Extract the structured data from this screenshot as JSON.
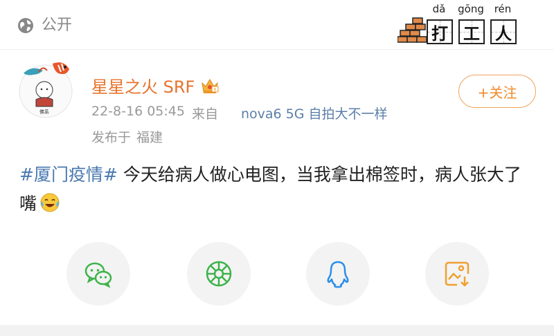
{
  "header": {
    "privacy_label": "公开",
    "privacy_icon": "globe-icon",
    "stamp": {
      "pinyin": [
        "dǎ",
        "gōng",
        "rén"
      ],
      "chars": [
        "打",
        "工",
        "人"
      ]
    }
  },
  "author": {
    "name": "星星之火 SRF",
    "badge_icon": "crown-badge-icon",
    "date": "22-8-16 05:45",
    "source_prefix": "来自",
    "device": "nova6 5G 自拍大不一样",
    "location_prefix": "发布于",
    "location": "福建"
  },
  "follow_button": {
    "label": "+关注"
  },
  "post": {
    "hashtag": "#厦门疫情#",
    "text": " 今天给病人做心电图，当我拿出棉签时，病人张大了嘴",
    "emoji": "laughing-crying-emoji"
  },
  "share": {
    "items": [
      {
        "name": "wechat",
        "icon": "wechat-icon",
        "color": "#3cb34a"
      },
      {
        "name": "moments",
        "icon": "moments-icon",
        "color": "#3cb34a"
      },
      {
        "name": "qq",
        "icon": "qq-icon",
        "color": "#2b8ee8"
      },
      {
        "name": "save-image",
        "icon": "save-image-icon",
        "color": "#f0a030"
      }
    ]
  },
  "colors": {
    "username": "#e8732c",
    "hashtag": "#4a78b0",
    "follow": "#f08a2a",
    "meta": "#999999"
  }
}
